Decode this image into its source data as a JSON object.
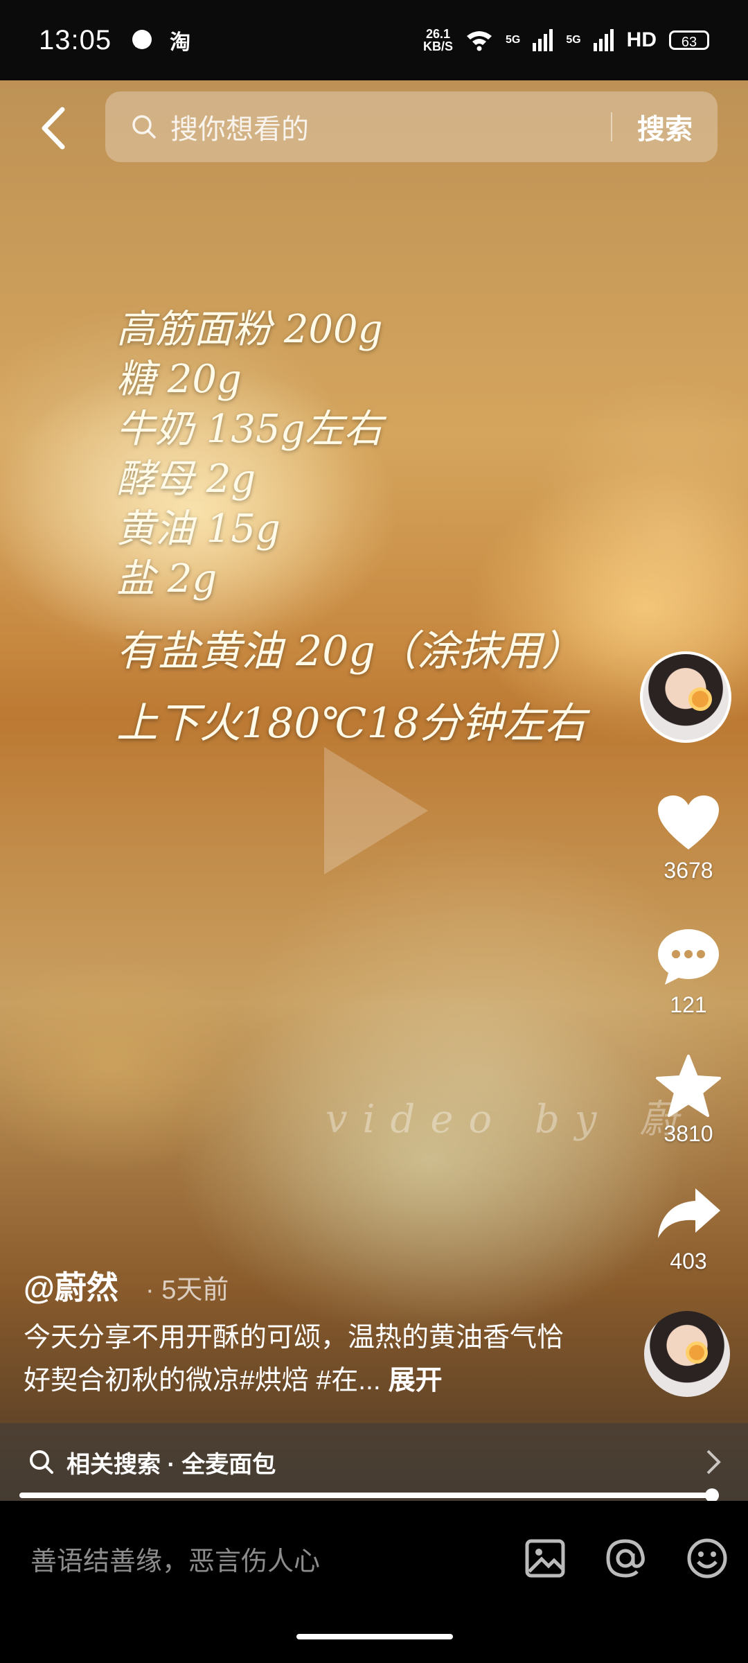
{
  "status_bar": {
    "time": "13:05",
    "app_icon": "淘",
    "net_speed_value": "26.1",
    "net_speed_unit": "KB/S",
    "signal1": "5G",
    "signal2": "5G",
    "hd": "HD",
    "battery": "63"
  },
  "search": {
    "placeholder": "搜你想看的",
    "button": "搜索"
  },
  "recipe": {
    "lines": [
      "高筋面粉 200g",
      "糖 20g",
      "牛奶 135g左右",
      "酵母 2g",
      "黄油 15g",
      "盐 2g"
    ],
    "extra": "有盐黄油 20g（涂抹用）",
    "bake": "上下火180℃18分钟左右",
    "watermark": "video by 蔚"
  },
  "actions": {
    "likes": "3678",
    "comments": "121",
    "favorites": "3810",
    "shares": "403"
  },
  "post": {
    "author": "@蔚然",
    "time": "· 5天前",
    "description": "今天分享不用开酥的可颂，温热的黄油香气恰好契合初秋的微凉#烘焙 #在...",
    "expand": "展开"
  },
  "related": {
    "label": "相关搜索 · 全麦面包"
  },
  "progress": {
    "fraction": 0.99
  },
  "comment_bar": {
    "placeholder": "善语结善缘，恶言伤人心"
  },
  "icons": [
    "back-icon",
    "search-icon",
    "heart-icon",
    "comment-icon",
    "star-icon",
    "share-icon",
    "image-icon",
    "at-icon",
    "emoji-icon",
    "chevron-right-icon"
  ]
}
